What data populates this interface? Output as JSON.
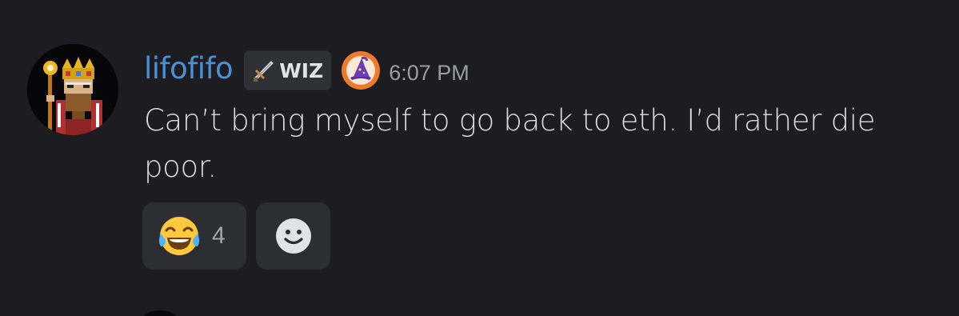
{
  "message": {
    "username": "lifofifo",
    "role_tag": {
      "icon": "sword-icon",
      "label": "WIZ"
    },
    "role_badge_icon": "wizard-hat-icon",
    "timestamp": "6:07 PM",
    "text": "Can’t bring myself to go back to eth. I’d rather die poor."
  },
  "reactions": [
    {
      "emoji": "joy-emoji",
      "count": "4"
    }
  ],
  "add_reaction_icon": "smiley-icon",
  "colors": {
    "background": "#1c1c21",
    "username": "#4a90d6",
    "badge_orange": "#f07a2b",
    "hat_purple": "#6a3bb8"
  }
}
